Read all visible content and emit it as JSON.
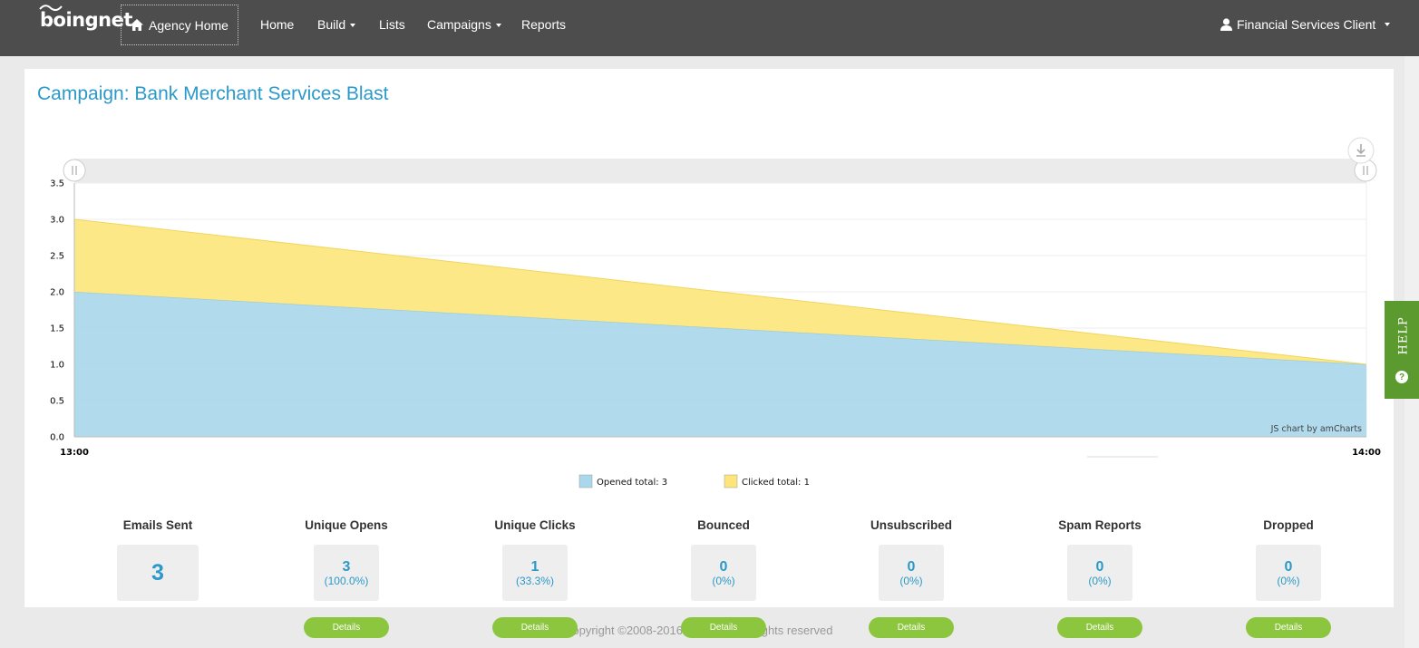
{
  "brand": {
    "logo_text": "boingnet"
  },
  "nav": {
    "agency_home": "Agency Home",
    "items": [
      {
        "label": "Home",
        "has_caret": false
      },
      {
        "label": "Build",
        "has_caret": true
      },
      {
        "label": "Lists",
        "has_caret": false
      },
      {
        "label": "Campaigns",
        "has_caret": true
      },
      {
        "label": "Reports",
        "has_caret": false
      }
    ],
    "user_label": "Financial Services Client"
  },
  "page": {
    "title": "Campaign: Bank Merchant Services Blast"
  },
  "chart_data": {
    "type": "area",
    "stacked": true,
    "x": [
      "13:00",
      "14:00"
    ],
    "series": [
      {
        "name": "Opened",
        "values": [
          2,
          1
        ],
        "color": "#a9d7eb"
      },
      {
        "name": "Clicked",
        "values": [
          1,
          0
        ],
        "color": "#fde57a"
      }
    ],
    "yticks": [
      "0.0",
      "0.5",
      "1.0",
      "1.5",
      "2.0",
      "2.5",
      "3.0",
      "3.5"
    ],
    "ylim": [
      0,
      3.5
    ],
    "legend": [
      {
        "label": "Opened total: 3",
        "color": "#a9d7eb"
      },
      {
        "label": "Clicked total: 1",
        "color": "#fde57a"
      }
    ],
    "legend_position": "bottom",
    "credit": "JS chart by amCharts",
    "grid": true
  },
  "stats": [
    {
      "label": "Emails Sent",
      "value": "3",
      "pct": "",
      "details": ""
    },
    {
      "label": "Unique Opens",
      "value": "3",
      "pct": "(100.0%)",
      "details": "Details"
    },
    {
      "label": "Unique Clicks",
      "value": "1",
      "pct": "(33.3%)",
      "details": "Details"
    },
    {
      "label": "Bounced",
      "value": "0",
      "pct": "(0%)",
      "details": "Details"
    },
    {
      "label": "Unsubscribed",
      "value": "0",
      "pct": "(0%)",
      "details": "Details"
    },
    {
      "label": "Spam Reports",
      "value": "0",
      "pct": "(0%)",
      "details": "Details"
    },
    {
      "label": "Dropped",
      "value": "0",
      "pct": "(0%)",
      "details": "Details"
    }
  ],
  "footer": {
    "text": "Copyright ©2008-2016 Boingnet. All rights reserved"
  },
  "help": {
    "label": "HELP",
    "icon": "?"
  },
  "colors": {
    "accent": "#2b99c9",
    "nav_bg": "#4d4d4d",
    "button_green": "#8cc63f",
    "help_green": "#5b9a2e"
  }
}
